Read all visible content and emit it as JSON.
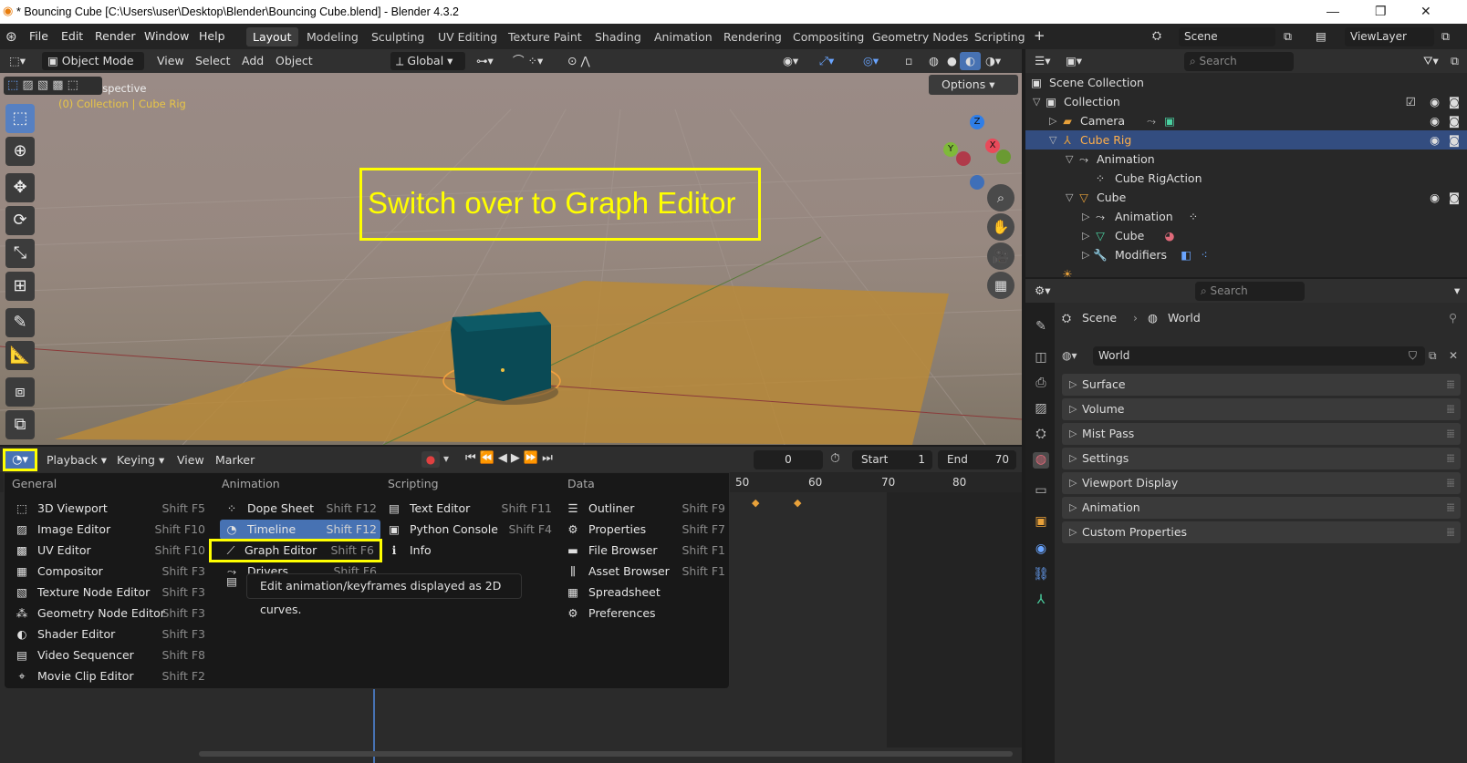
{
  "window": {
    "title": "* Bouncing Cube [C:\\Users\\user\\Desktop\\Blender\\Bouncing Cube.blend] - Blender 4.3.2"
  },
  "menubar": {
    "menus": [
      "File",
      "Edit",
      "Render",
      "Window",
      "Help"
    ],
    "workspaces": [
      "Layout",
      "Modeling",
      "Sculpting",
      "UV Editing",
      "Texture Paint",
      "Shading",
      "Animation",
      "Rendering",
      "Compositing",
      "Geometry Nodes",
      "Scripting"
    ],
    "active_workspace": "Layout",
    "scene": "Scene",
    "view_layer": "ViewLayer"
  },
  "viewport": {
    "mode": "Object Mode",
    "menus": [
      "View",
      "Select",
      "Add",
      "Object"
    ],
    "transform_orientation": "Global",
    "options_label": "Options",
    "perspective_label": "User Perspective",
    "collection_label": "(0) Collection | Cube Rig",
    "gizmo_axes": [
      "Z",
      "X",
      "Y"
    ]
  },
  "annotation": {
    "text": "Switch over to Graph Editor"
  },
  "timeline": {
    "menus": [
      "Playback",
      "Keying",
      "View",
      "Marker"
    ],
    "current_frame": "0",
    "start_label": "Start",
    "start_value": "1",
    "end_label": "End",
    "end_value": "70",
    "ruler_ticks": [
      "50",
      "60",
      "70",
      "80"
    ]
  },
  "editor_menu": {
    "columns": [
      {
        "heading": "General",
        "items": [
          {
            "label": "3D Viewport",
            "shortcut": "Shift F5",
            "icon": "viewport-icon"
          },
          {
            "label": "Image Editor",
            "shortcut": "Shift F10",
            "icon": "image-icon"
          },
          {
            "label": "UV Editor",
            "shortcut": "Shift F10",
            "icon": "uv-icon"
          },
          {
            "label": "Compositor",
            "shortcut": "Shift F3",
            "icon": "compositor-icon"
          },
          {
            "label": "Texture Node Editor",
            "shortcut": "Shift F3",
            "icon": "texture-icon"
          },
          {
            "label": "Geometry Node Editor",
            "shortcut": "Shift F3",
            "icon": "geometry-icon"
          },
          {
            "label": "Shader Editor",
            "shortcut": "Shift F3",
            "icon": "shader-icon"
          },
          {
            "label": "Video Sequencer",
            "shortcut": "Shift F8",
            "icon": "sequencer-icon"
          },
          {
            "label": "Movie Clip Editor",
            "shortcut": "Shift F2",
            "icon": "clip-icon"
          }
        ]
      },
      {
        "heading": "Animation",
        "items": [
          {
            "label": "Dope Sheet",
            "shortcut": "Shift F12",
            "icon": "dopesheet-icon"
          },
          {
            "label": "Timeline",
            "shortcut": "Shift F12",
            "icon": "timeline-icon"
          },
          {
            "label": "Graph Editor",
            "shortcut": "Shift F6",
            "icon": "graph-icon"
          },
          {
            "label": "Drivers",
            "shortcut": "Shift F6",
            "icon": "drivers-icon"
          },
          {
            "label": "N",
            "shortcut": "",
            "icon": "nla-icon"
          }
        ]
      },
      {
        "heading": "Scripting",
        "items": [
          {
            "label": "Text Editor",
            "shortcut": "Shift F11",
            "icon": "text-icon"
          },
          {
            "label": "Python Console",
            "shortcut": "Shift F4",
            "icon": "console-icon"
          },
          {
            "label": "Info",
            "shortcut": "",
            "icon": "info-icon"
          }
        ]
      },
      {
        "heading": "Data",
        "items": [
          {
            "label": "Outliner",
            "shortcut": "Shift F9",
            "icon": "outliner-icon"
          },
          {
            "label": "Properties",
            "shortcut": "Shift F7",
            "icon": "properties-icon"
          },
          {
            "label": "File Browser",
            "shortcut": "Shift F1",
            "icon": "filebrowser-icon"
          },
          {
            "label": "Asset Browser",
            "shortcut": "Shift F1",
            "icon": "asset-icon"
          },
          {
            "label": "Spreadsheet",
            "shortcut": "",
            "icon": "spreadsheet-icon"
          },
          {
            "label": "Preferences",
            "shortcut": "",
            "icon": "preferences-icon"
          }
        ]
      }
    ],
    "highlighted": "Timeline",
    "tooltip": "Edit animation/keyframes displayed as 2D curves."
  },
  "outliner": {
    "search_placeholder": "Search",
    "root": "Scene Collection",
    "rows": [
      {
        "label": "Collection",
        "indent": 1
      },
      {
        "label": "Camera",
        "indent": 2
      },
      {
        "label": "Cube Rig",
        "indent": 2,
        "selected": true
      },
      {
        "label": "Animation",
        "indent": 3
      },
      {
        "label": "Cube RigAction",
        "indent": 4
      },
      {
        "label": "Cube",
        "indent": 3
      },
      {
        "label": "Animation",
        "indent": 4
      },
      {
        "label": "Cube",
        "indent": 4
      },
      {
        "label": "Modifiers",
        "indent": 4
      }
    ]
  },
  "properties": {
    "search_placeholder": "Search",
    "breadcrumb": [
      "Scene",
      "World"
    ],
    "world_name": "World",
    "panels": [
      "Surface",
      "Volume",
      "Mist Pass",
      "Settings",
      "Viewport Display",
      "Animation",
      "Custom Properties"
    ]
  },
  "colors": {
    "accent": "#4772b3",
    "annotation": "#ffff00",
    "selected_row": "#334d80",
    "keyframe": "#e8a13a"
  }
}
